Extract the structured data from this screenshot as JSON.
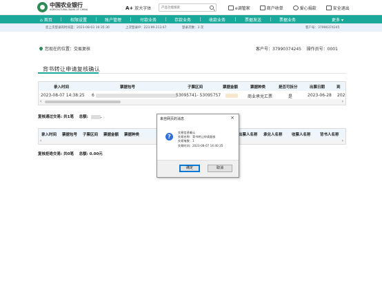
{
  "header": {
    "logo_cn": "中国农业银行",
    "logo_en": "AGRICULTURAL BANK OF CHINA",
    "font_toggle_a": "A+",
    "font_toggle_label": "放大字体",
    "search_placeholder": "产品功能搜索",
    "links": [
      {
        "icon": "message-icon",
        "label": "e调管家"
      },
      {
        "icon": "merchant-icon",
        "label": "商户收单"
      },
      {
        "icon": "donate-icon",
        "label": "爱心捐款"
      },
      {
        "icon": "logout-icon",
        "label": "安全退出"
      }
    ]
  },
  "nav": {
    "home": "首页",
    "items": [
      "权限设置",
      "账户管理",
      "付款业务",
      "存款业务",
      "收款业务",
      "票据发送",
      "票据业务"
    ],
    "more": "更多"
  },
  "info": {
    "last_login": "您上次登录的时间是：2023-08-03 16:35:30",
    "last_ip": "上次登录IP：223.99.213.67",
    "login_count": "登录次数：3 次",
    "customer_no": "客户号：37990374245"
  },
  "breadcrumb": {
    "label": "您现在的位置：交易复核",
    "customer_no": "客户号：37990374245",
    "operator_no": "操作员号：0001"
  },
  "page_title": "背书转让申请复核确认",
  "table1": {
    "headers": [
      "录入时间",
      "票据包号",
      "子票区间",
      "票据金额",
      "票据种类",
      "是否可拆分",
      "出票日期",
      "到"
    ],
    "row": [
      "2023-08-07 14:38:25",
      "6",
      "53095741- 53095757",
      "",
      "商业承兑汇票",
      "是",
      "2023-06-28",
      "202"
    ]
  },
  "summary1": {
    "label": "复核通过交易: 共1笔",
    "amount_label": "总额:",
    "amount_suffix": "."
  },
  "table2": {
    "headers": [
      "录入时间",
      "票据包号",
      "子票区间",
      "票据金额",
      "票据种类",
      "出票人名称",
      "承兑人名称",
      "收票人名称",
      "背书人名称"
    ]
  },
  "summary2": {
    "label": "复核拒绝交易: 共0笔",
    "amount": "总额: 0.00元"
  },
  "dialog": {
    "title": "来自网页的消息",
    "lines": [
      "交易信息确认",
      "交易名称：背书转让申请复核",
      "交易笔数：1",
      "交易时间：2023-08-07 14:40:35"
    ],
    "ok": "确定",
    "cancel": "取消"
  },
  "colors": {
    "brand": "#1aa89a",
    "logo": "#2e8b57",
    "info_bg": "#e8f1fb"
  }
}
